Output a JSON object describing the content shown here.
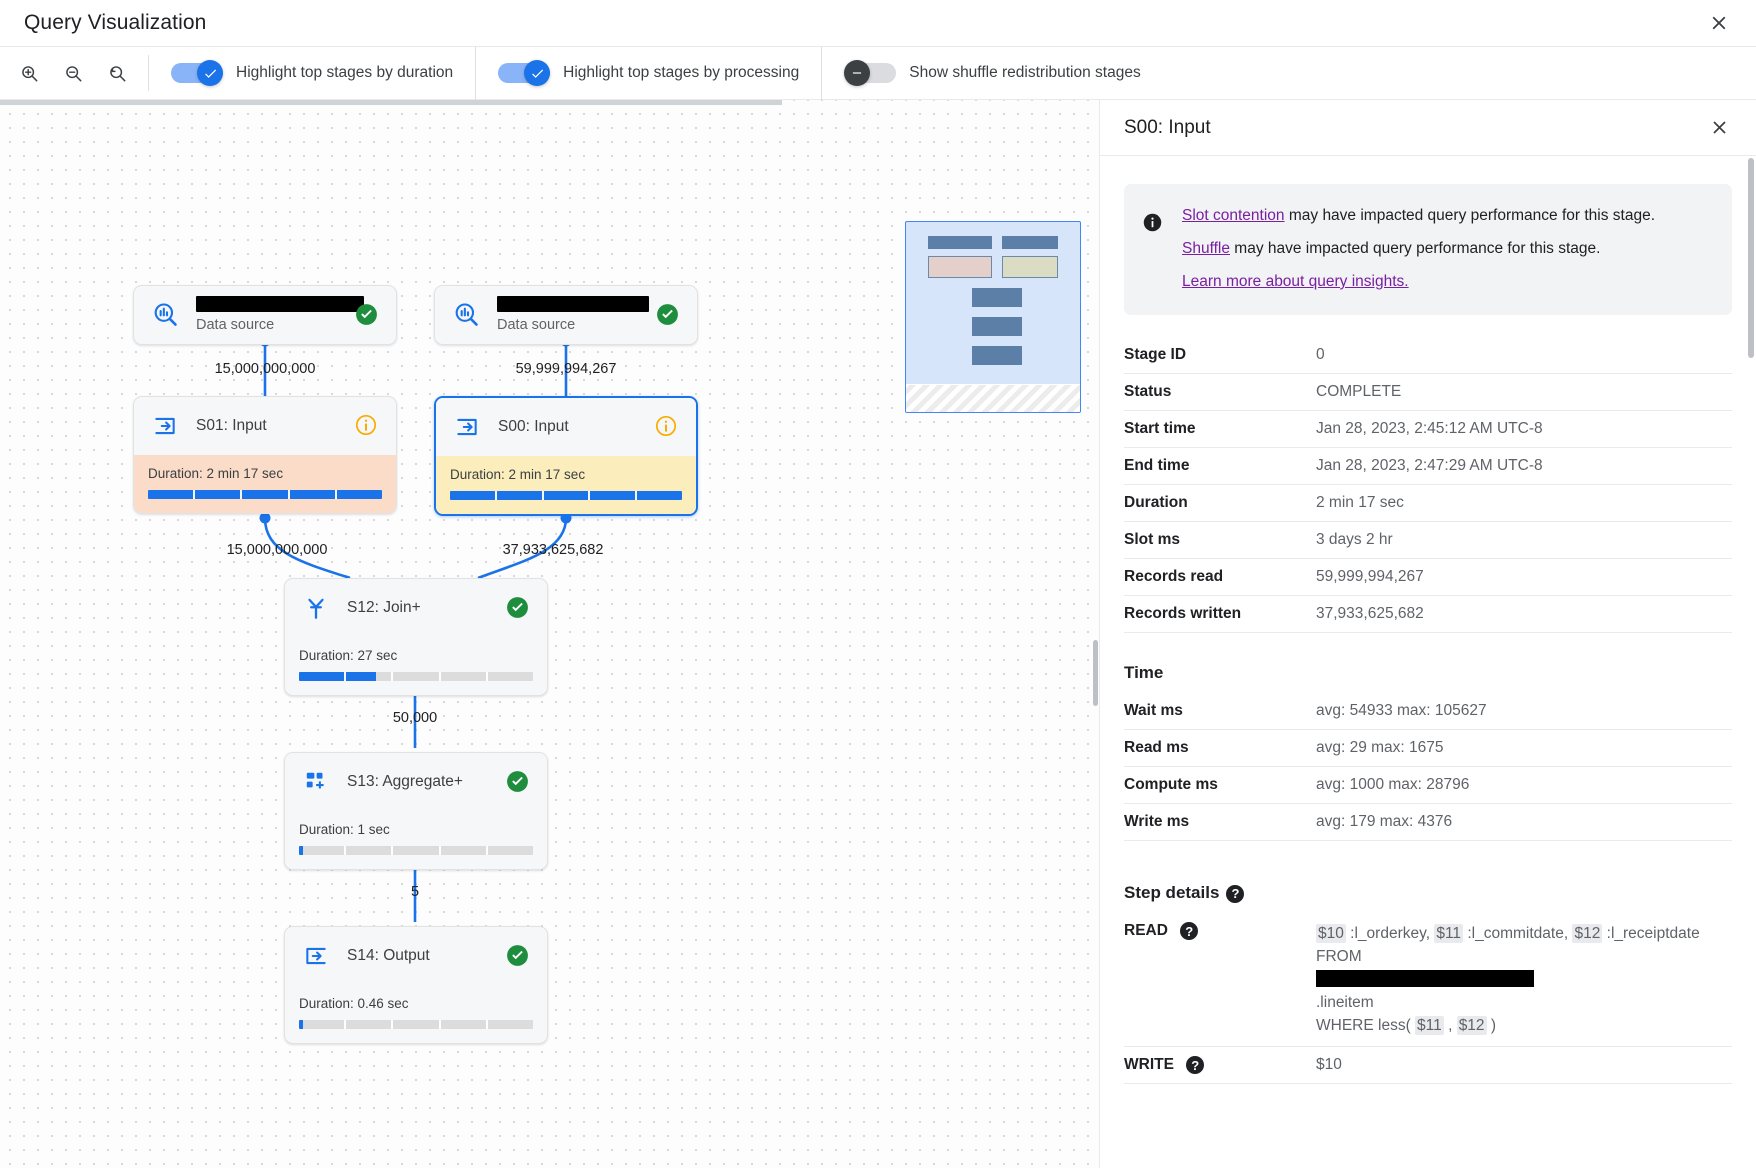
{
  "window": {
    "title": "Query Visualization",
    "close_label": "✕"
  },
  "toolbar": {
    "zoom_in": "Zoom in",
    "zoom_out": "Zoom out",
    "zoom_reset": "Reset zoom",
    "toggles": [
      {
        "label": "Highlight top stages by duration",
        "on": true
      },
      {
        "label": "Highlight top stages by processing",
        "on": true
      },
      {
        "label": "Show shuffle redistribution stages",
        "on": false
      }
    ]
  },
  "graph": {
    "nodes": [
      {
        "id": "ds1",
        "kind": "datasource",
        "icon": "data-source-search-icon",
        "title_redacted": true,
        "subtitle": "Data source",
        "status": "complete"
      },
      {
        "id": "ds2",
        "kind": "datasource",
        "icon": "data-source-search-icon",
        "title_redacted": true,
        "subtitle": "Data source",
        "status": "complete"
      },
      {
        "id": "s01",
        "kind": "stage",
        "icon": "input-arrow-icon",
        "title": "S01: Input",
        "status": "info",
        "duration_label": "Duration: 2 min 17 sec",
        "bar_percent": 100,
        "tint": "warm"
      },
      {
        "id": "s00",
        "kind": "stage",
        "icon": "input-arrow-icon",
        "title": "S00: Input",
        "status": "info",
        "duration_label": "Duration: 2 min 17 sec",
        "bar_percent": 100,
        "tint": "yellow",
        "selected": true
      },
      {
        "id": "s12",
        "kind": "stage",
        "icon": "join-merge-icon",
        "title": "S12: Join+",
        "status": "complete",
        "duration_label": "Duration: 27 sec",
        "bar_percent": 33,
        "tint": "plain"
      },
      {
        "id": "s13",
        "kind": "stage",
        "icon": "aggregate-icon",
        "title": "S13: Aggregate+",
        "status": "complete",
        "duration_label": "Duration: 1 sec",
        "bar_percent": 1.5,
        "tint": "plain"
      },
      {
        "id": "s14",
        "kind": "stage",
        "icon": "output-arrow-icon",
        "title": "S14: Output",
        "status": "complete",
        "duration_label": "Duration: 0.46 sec",
        "bar_percent": 1.5,
        "tint": "plain"
      }
    ],
    "edge_labels": [
      {
        "id": "e1",
        "text": "15,000,000,000"
      },
      {
        "id": "e2",
        "text": "59,999,994,267"
      },
      {
        "id": "e3",
        "text": "15,000,000,000"
      },
      {
        "id": "e4",
        "text": "37,933,625,682"
      },
      {
        "id": "e5",
        "text": "50,000"
      },
      {
        "id": "e6",
        "text": "5"
      }
    ]
  },
  "panel": {
    "title": "S00: Input",
    "close_label": "✕",
    "insight": {
      "link1": "Slot contention",
      "text1": " may have impacted query performance for this stage.",
      "link2": "Shuffle",
      "text2": " may have impacted query performance for this stage.",
      "link3": "Learn more about query insights."
    },
    "details": [
      {
        "key": "Stage ID",
        "value": "0"
      },
      {
        "key": "Status",
        "value": "COMPLETE"
      },
      {
        "key": "Start time",
        "value": "Jan 28, 2023, 2:45:12 AM UTC-8"
      },
      {
        "key": "End time",
        "value": "Jan 28, 2023, 2:47:29 AM UTC-8"
      },
      {
        "key": "Duration",
        "value": "2 min 17 sec"
      },
      {
        "key": "Slot ms",
        "value": "3 days 2 hr"
      },
      {
        "key": "Records read",
        "value": "59,999,994,267"
      },
      {
        "key": "Records written",
        "value": "37,933,625,682"
      }
    ],
    "time_section_title": "Time",
    "time_rows": [
      {
        "key": "Wait ms",
        "value": "avg: 54933 max: 105627"
      },
      {
        "key": "Read ms",
        "value": "avg: 29 max: 1675"
      },
      {
        "key": "Compute ms",
        "value": "avg: 1000 max: 28796"
      },
      {
        "key": "Write ms",
        "value": "avg: 179 max: 4376"
      }
    ],
    "step_details_title": "Step details",
    "read_label": "READ",
    "read_tokens": {
      "t1": "$10",
      "t2": " :l_orderkey, ",
      "t3": "$11",
      "t4": " :l_commitdate, ",
      "t5": "$12",
      "t6": " :l_receiptdate",
      "t7": "FROM",
      "t8": ".lineitem",
      "t9": "WHERE less( ",
      "t10": "$11",
      "t11": " , ",
      "t12": "$12",
      "t13": " )"
    },
    "write_label": "WRITE",
    "write_value": "$10"
  },
  "colors": {
    "accent": "#1a73e8",
    "toggle_on_track": "#8ab4f8",
    "success": "#1e8e3e",
    "warning": "#f9ab00",
    "link_visited": "#7b1fa2",
    "stage_warm": "#fadcc8",
    "stage_yellow": "#fbeebc"
  }
}
